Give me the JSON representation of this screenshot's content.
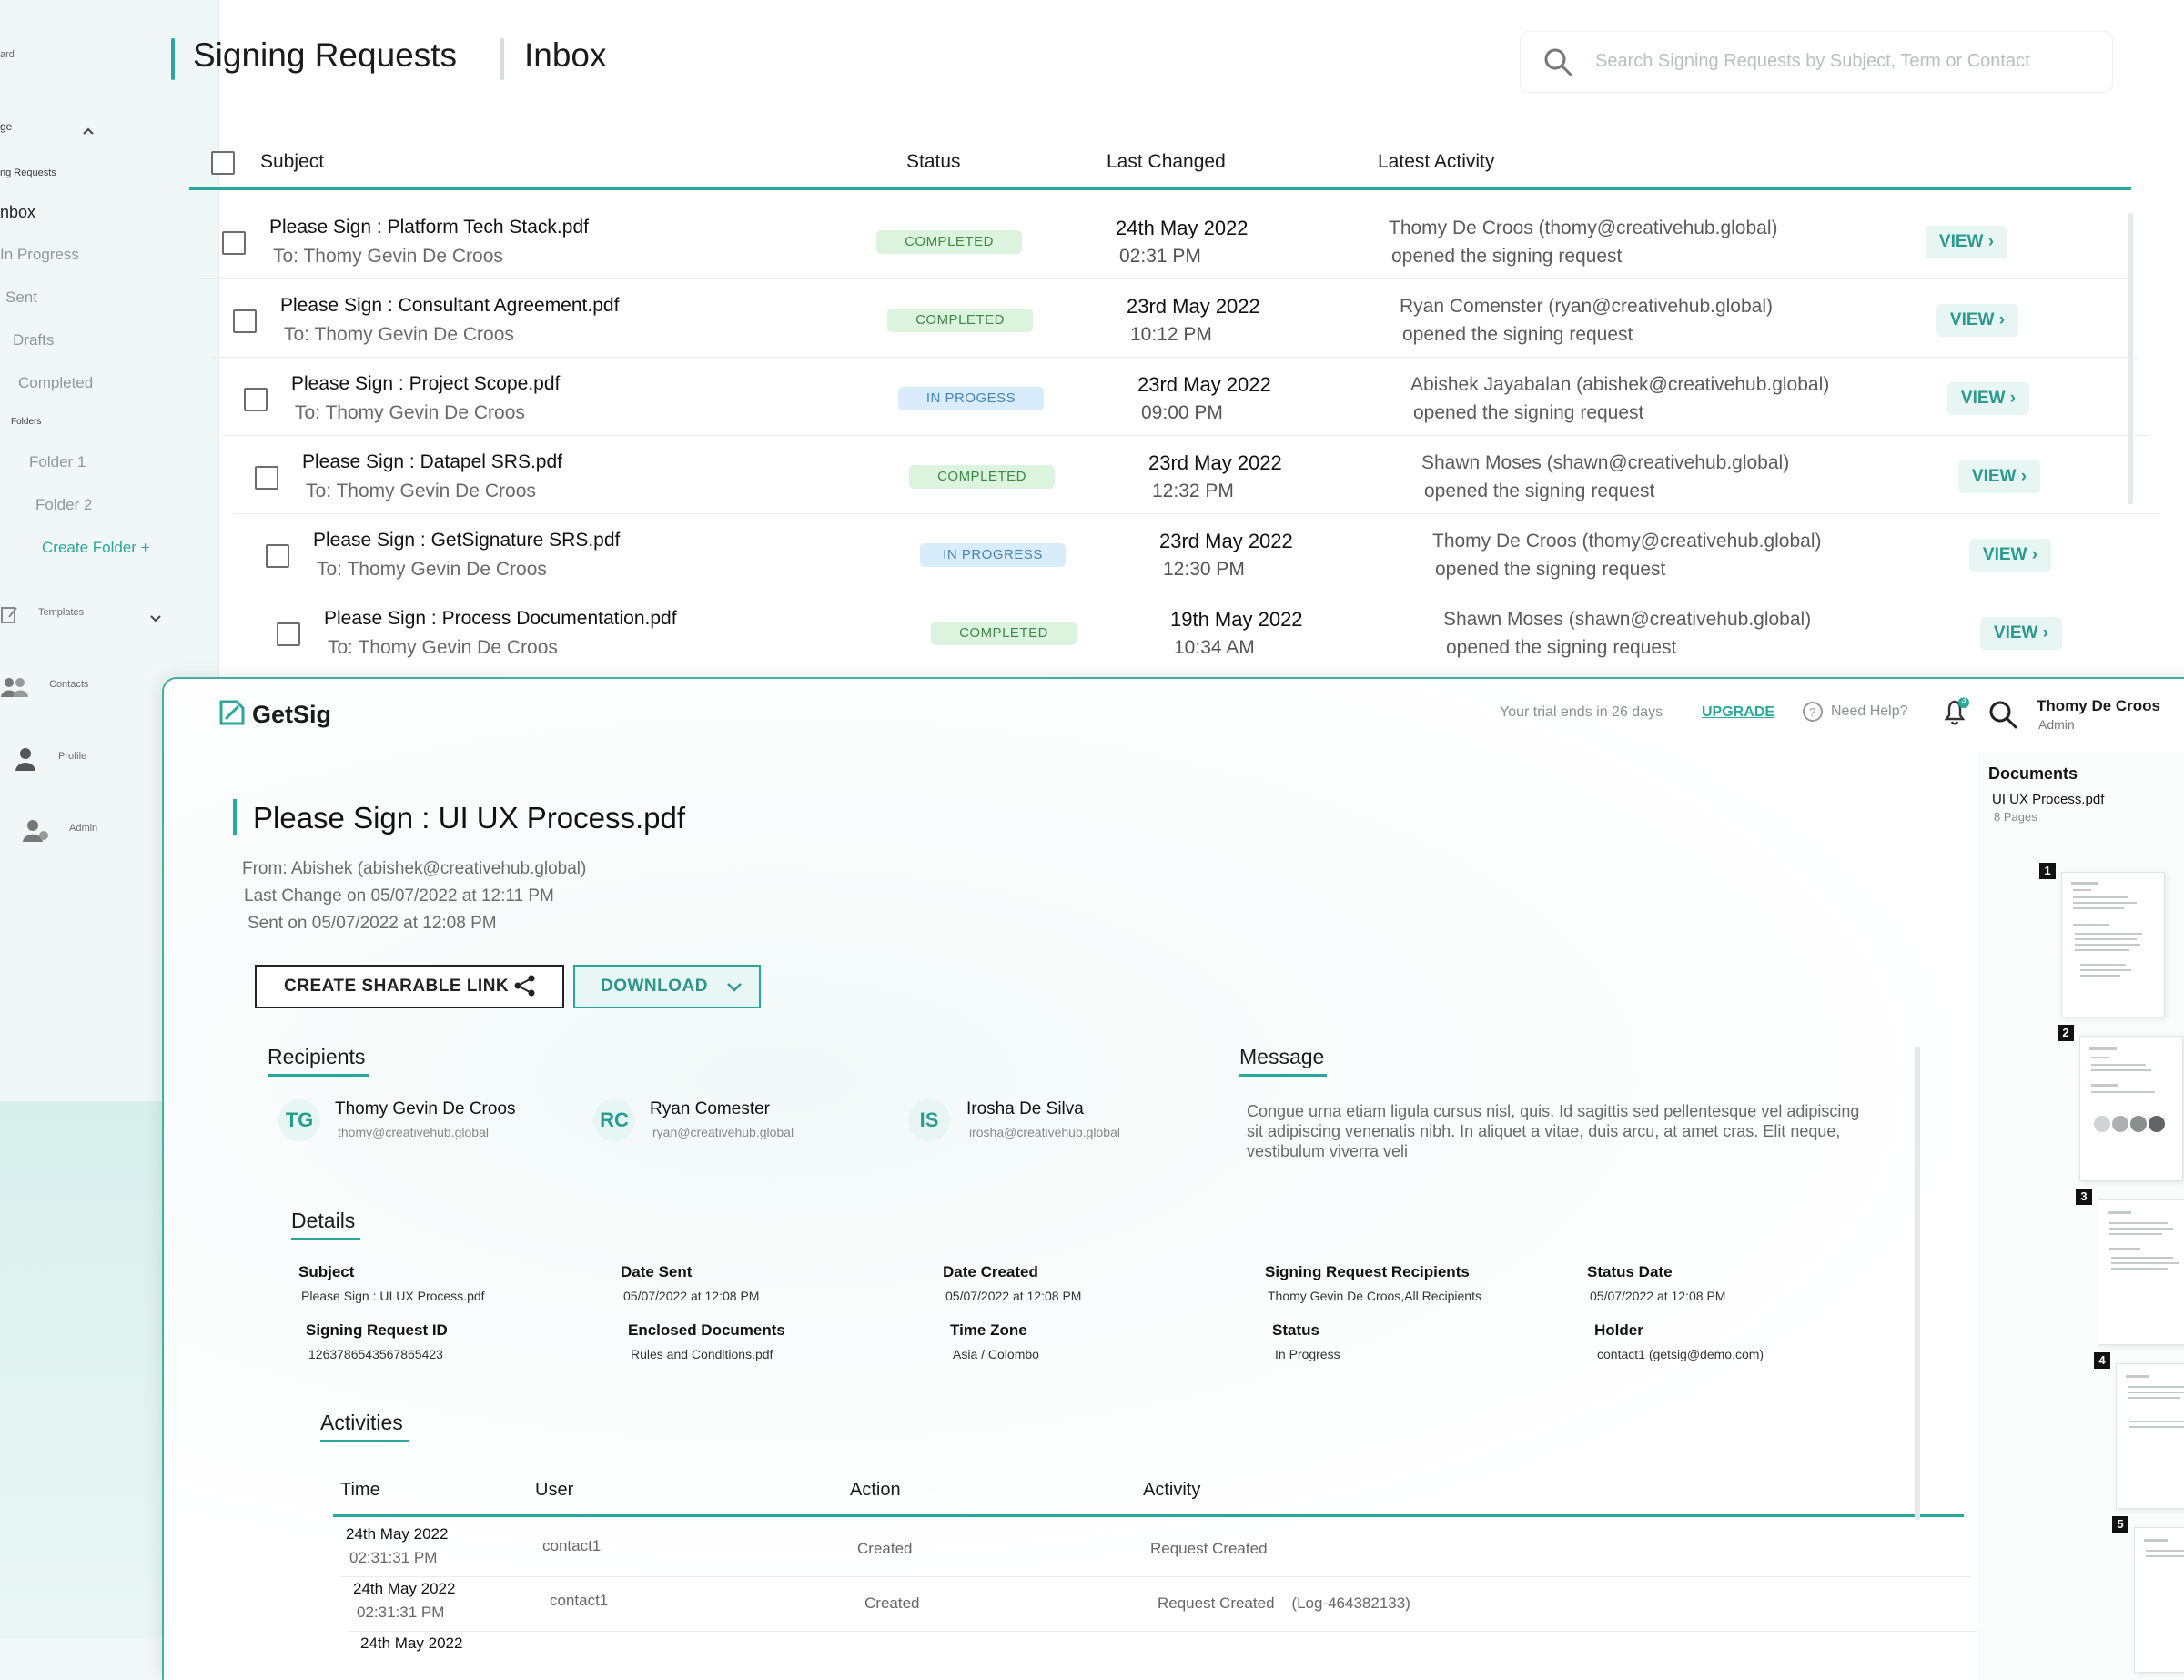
{
  "back": {
    "sidebar": {
      "top_partial": "ard",
      "group_partial": "ge",
      "sub_group": "ng Requests",
      "items": [
        "nbox",
        "In Progress",
        "Sent",
        "Drafts",
        "Completed"
      ],
      "folders_label": "Folders",
      "folders": [
        "Folder 1",
        "Folder 2"
      ],
      "create_folder": "Create Folder +",
      "templates": "Templates",
      "contacts": "Contacts",
      "profile": "Profile",
      "admin": "Admin"
    },
    "title": "Signing Requests",
    "subtitle": "Inbox",
    "search_placeholder": "Search Signing Requests by Subject, Term or Contact",
    "columns": [
      "Subject",
      "Status",
      "Last Changed",
      "Latest Activity"
    ],
    "rows": [
      {
        "subject": "Please Sign : Platform Tech Stack.pdf",
        "to": "To: Thomy Gevin De Croos",
        "status": "COMPLETED",
        "date": "24th May 2022",
        "time": "02:31 PM",
        "activity": "Thomy De Croos (thomy@creativehub.global)",
        "activity2": "opened the signing request",
        "view": "VIEW"
      },
      {
        "subject": "Please Sign : Consultant Agreement.pdf",
        "to": "To: Thomy Gevin De Croos",
        "status": "COMPLETED",
        "date": "23rd May 2022",
        "time": "10:12 PM",
        "activity": "Ryan Comenster (ryan@creativehub.global)",
        "activity2": "opened the signing request",
        "view": "VIEW"
      },
      {
        "subject": "Please Sign : Project Scope.pdf",
        "to": "To: Thomy Gevin De Croos",
        "status": "IN PROGESS",
        "date": "23rd May 2022",
        "time": "09:00 PM",
        "activity": "Abishek Jayabalan (abishek@creativehub.global)",
        "activity2": "opened the signing request",
        "view": "VIEW"
      },
      {
        "subject": "Please Sign : Datapel SRS.pdf",
        "to": "To: Thomy Gevin De Croos",
        "status": "COMPLETED",
        "date": "23rd May 2022",
        "time": "12:32 PM",
        "activity": "Shawn Moses (shawn@creativehub.global)",
        "activity2": "opened the signing request",
        "view": "VIEW"
      },
      {
        "subject": "Please Sign : GetSignature SRS.pdf",
        "to": "To: Thomy Gevin De Croos",
        "status": "IN PROGRESS",
        "date": "23rd May 2022",
        "time": "12:30 PM",
        "activity": "Thomy De Croos (thomy@creativehub.global)",
        "activity2": "opened the signing request",
        "view": "VIEW"
      },
      {
        "subject": "Please Sign : Process Documentation.pdf",
        "to": "To: Thomy Gevin De Croos",
        "status": "COMPLETED",
        "date": "19th May 2022",
        "time": "10:34 AM",
        "activity": "Shawn Moses (shawn@creativehub.global)",
        "activity2": "opened the signing request",
        "view": "VIEW"
      }
    ]
  },
  "front": {
    "logo": "GetSig",
    "trial": "Your trial ends in 26 days",
    "upgrade": "UPGRADE",
    "help": "Need Help?",
    "notif_count": "3",
    "user_name": "Thomy De Croos",
    "user_role": "Admin",
    "doc_title": "Please Sign : UI UX Process.pdf",
    "from": "From: Abishek (abishek@creativehub.global)",
    "last_change": "Last Change on 05/07/2022 at 12:11 PM",
    "sent_on": "Sent on 05/07/2022 at 12:08 PM",
    "share_btn": "CREATE SHARABLE LINK",
    "download_btn": "DOWNLOAD",
    "recipients_h": "Recipients",
    "recipients": [
      {
        "initials": "TG",
        "name": "Thomy Gevin De Croos",
        "email": "thomy@creativehub.global"
      },
      {
        "initials": "RC",
        "name": "Ryan Comester",
        "email": "ryan@creativehub.global"
      },
      {
        "initials": "IS",
        "name": "Irosha De Silva",
        "email": "irosha@creativehub.global"
      }
    ],
    "message_h": "Message",
    "message": "Congue urna etiam ligula cursus nisl, quis. Id sagittis sed pellentesque vel adipiscing sit adipiscing venenatis nibh. In aliquet a vitae, duis arcu, at amet cras. Elit neque, vestibulum viverra veli",
    "details_h": "Details",
    "details": [
      {
        "label": "Subject",
        "value": "Please Sign : UI UX Process.pdf"
      },
      {
        "label": "Date Sent",
        "value": "05/07/2022 at 12:08 PM"
      },
      {
        "label": "Date Created",
        "value": "05/07/2022 at 12:08 PM"
      },
      {
        "label": "Signing Request Recipients",
        "value": "Thomy Gevin De Croos,All Recipients"
      },
      {
        "label": "Status Date",
        "value": "05/07/2022 at 12:08 PM"
      },
      {
        "label": "Signing Request ID",
        "value": "1263786543567865423"
      },
      {
        "label": "Enclosed Documents",
        "value": "Rules and Conditions.pdf"
      },
      {
        "label": "Time Zone",
        "value": "Asia / Colombo"
      },
      {
        "label": "Status",
        "value": "In Progress"
      },
      {
        "label": "Holder",
        "value": "contact1 (getsig@demo.com)"
      }
    ],
    "activities_h": "Activities",
    "act_columns": [
      "Time",
      "User",
      "Action",
      "Activity"
    ],
    "activities": [
      {
        "date": "24th May 2022",
        "time": "02:31:31 PM",
        "user": "contact1",
        "action": "Created",
        "activity": "Request Created"
      },
      {
        "date": "24th May 2022",
        "time": "02:31:31 PM",
        "user": "contact1",
        "action": "Created",
        "activity": "Request Created    (Log-464382133)"
      },
      {
        "date": "24th May 2022",
        "time": "",
        "user": "",
        "action": "",
        "activity": ""
      }
    ],
    "documents_h": "Documents",
    "doc_name": "UI UX Process.pdf",
    "doc_pages": "8 Pages",
    "page_numbers": [
      "1",
      "2",
      "3",
      "4",
      "5"
    ]
  }
}
